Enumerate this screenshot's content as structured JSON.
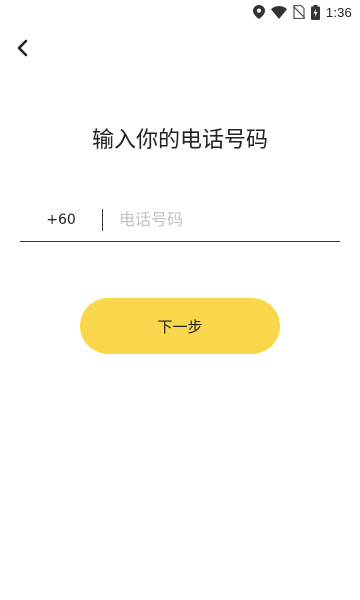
{
  "status_bar": {
    "time": "1:36",
    "icons": [
      "location-icon",
      "wifi-icon",
      "no-sim-icon",
      "battery-charging-icon"
    ]
  },
  "header": {
    "back_icon": "chevron-left-icon"
  },
  "page": {
    "title": "输入你的电话号码"
  },
  "phone_field": {
    "country_code": "+60",
    "placeholder": "电话号码",
    "value": ""
  },
  "actions": {
    "next_label": "下一步"
  },
  "colors": {
    "accent": "#f9d74c",
    "text": "#222222",
    "placeholder": "#c2c2c2",
    "underline": "#333333"
  }
}
